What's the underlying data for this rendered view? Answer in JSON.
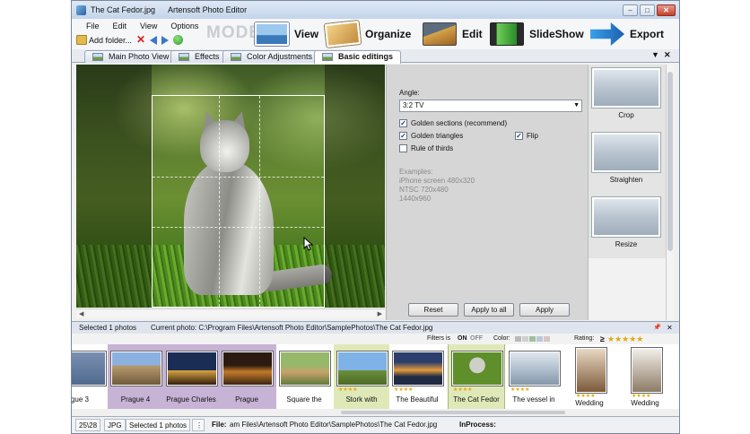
{
  "window": {
    "file_title": "The Cat Fedor.jpg",
    "app_title": "Artensoft Photo Editor",
    "min": "–",
    "max": "□",
    "close": "✕"
  },
  "menu": [
    "File",
    "Edit",
    "View",
    "Options"
  ],
  "quickbar": {
    "add_folder": "Add folder..."
  },
  "modes": {
    "label": "MODE:",
    "view": "View",
    "organize": "Organize",
    "edit": "Edit",
    "slideshow": "SlideShow",
    "export": "Export"
  },
  "tabs": [
    "Main Photo View",
    "Effects",
    "Color Adjustments",
    "Basic editings"
  ],
  "tab_controls": {
    "dropdown": "▼",
    "close": "✕"
  },
  "settings": {
    "angle_label": "Angle:",
    "angle_value": "3:2 TV",
    "golden_sections": "Golden sections (recommend)",
    "golden_triangles": "Golden triangles",
    "flip": "Flip",
    "rule_of_thirds": "Rule of thirds",
    "examples": [
      "Examples:",
      "iPhone screen 480x320",
      "NTSC 720x480",
      "1440x960"
    ],
    "checked_mark": "✓",
    "reset": "Reset",
    "apply_to_all": "Apply to all",
    "apply": "Apply"
  },
  "actions": [
    "Crop",
    "Straighten",
    "Resize"
  ],
  "infobar": {
    "selected": "Selected 1 photos",
    "current_photo": "Current photo: C:\\Program Files\\Artensoft Photo Editor\\SamplePhotos\\The Cat Fedor.jpg",
    "pin": "📌",
    "close": "✕"
  },
  "filterbar": {
    "filters_label": "Filters is",
    "on": "ON",
    "off": "OFF",
    "color_label": "Color:",
    "rating_label": "Rating:",
    "rating_symbol": "≥",
    "rating_stars": "★★★★★"
  },
  "thumbnails": [
    {
      "name": "gue 3",
      "stars": ""
    },
    {
      "name": "Prague 4",
      "stars": ""
    },
    {
      "name": "Prague Charles",
      "stars": ""
    },
    {
      "name": "Prague",
      "stars": ""
    },
    {
      "name": "Square the",
      "stars": ""
    },
    {
      "name": "Stork with",
      "stars": "★★★★"
    },
    {
      "name": "The Beautiful",
      "stars": "★★★★"
    },
    {
      "name": "The Cat Fedor",
      "stars": "★★★★"
    },
    {
      "name": "The vessel in",
      "stars": "★★★★"
    },
    {
      "name": "Wedding",
      "stars": "★★★★"
    },
    {
      "name": "Wedding",
      "stars": "★★★★"
    }
  ],
  "statusbar": {
    "counter": "25\\28",
    "format": "JPG",
    "selected": "Selected 1 photos",
    "file_label": "File:",
    "file_path": "am Files\\Artensoft Photo Editor\\SamplePhotos\\The Cat Fedor.jpg",
    "inprocess_label": "InProcess:"
  },
  "colors": {
    "accent": "#3a78c9",
    "tab_active": "#ffffff",
    "selected_thumb": "#dfe9b8",
    "purple_group": "#c7b3d6"
  }
}
